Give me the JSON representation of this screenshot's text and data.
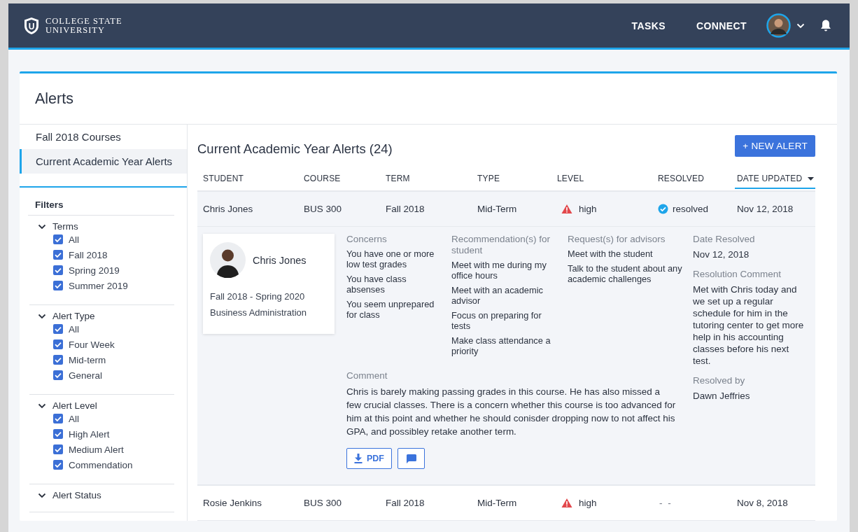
{
  "header": {
    "logo_letter": "U",
    "logo_line1": "COLLEGE STATE",
    "logo_line2": "UNIVERSITY",
    "nav": [
      "TASKS",
      "CONNECT"
    ]
  },
  "page_title": "Alerts",
  "sidebar": {
    "items": [
      {
        "label": "Fall 2018 Courses",
        "selected": false
      },
      {
        "label": "Current Academic Year Alerts",
        "selected": true
      }
    ],
    "filters_title": "Filters",
    "groups": [
      {
        "title": "Terms",
        "expanded": true,
        "items": [
          {
            "label": "All",
            "checked": true
          },
          {
            "label": "Fall 2018",
            "checked": true
          },
          {
            "label": "Spring 2019",
            "checked": true
          },
          {
            "label": "Summer 2019",
            "checked": true
          }
        ]
      },
      {
        "title": "Alert Type",
        "expanded": true,
        "items": [
          {
            "label": "All",
            "checked": true
          },
          {
            "label": "Four Week",
            "checked": true
          },
          {
            "label": "Mid-term",
            "checked": true
          },
          {
            "label": "General",
            "checked": true
          }
        ]
      },
      {
        "title": "Alert Level",
        "expanded": true,
        "items": [
          {
            "label": "All",
            "checked": true
          },
          {
            "label": "High Alert",
            "checked": true
          },
          {
            "label": "Medium Alert",
            "checked": true
          },
          {
            "label": "Commendation",
            "checked": true
          }
        ]
      },
      {
        "title": "Alert Status",
        "expanded": true
      }
    ]
  },
  "alerts": {
    "title": "Current Academic Year Alerts (24)",
    "new_button": "+ NEW ALERT",
    "columns": [
      {
        "label": "STUDENT",
        "sorted": false
      },
      {
        "label": "COURSE",
        "sorted": false
      },
      {
        "label": "TERM",
        "sorted": false
      },
      {
        "label": "TYPE",
        "sorted": false
      },
      {
        "label": "LEVEL",
        "sorted": false
      },
      {
        "label": "RESOLVED",
        "sorted": false
      },
      {
        "label": "DATE UPDATED",
        "sorted": true
      }
    ],
    "rows": [
      {
        "student": "Chris Jones",
        "course": "BUS 300",
        "term": "Fall 2018",
        "type": "Mid-Term",
        "alert_level": "high",
        "kind": "warning",
        "resolved": true,
        "resolved_text": "resolved",
        "date": "Nov 12, 2018",
        "expanded": true,
        "detail": {
          "student_name": "Chris Jones",
          "period": "Fall 2018 - Spring 2020",
          "program": "Business Administration",
          "sections": [
            {
              "title": "Concerns",
              "items": [
                "You have one or more low test grades",
                "You have class absenses",
                "You seem unprepared for class"
              ]
            },
            {
              "title": "Recommendation(s) for student",
              "items": [
                "Meet with me during my office hours",
                "Meet with an academic advisor",
                "Focus on preparing for tests",
                "Make class attendance a priority"
              ]
            },
            {
              "title": "Request(s) for advisors",
              "items": [
                "Meet with the student",
                "Talk to the student about any academic challenges"
              ]
            }
          ],
          "comment_title": "Comment",
          "comment": "Chris is barely making passing grades in this course. He has also missed a few crucial classes. There is a concern whether this course is too advanced for him at this point and whether he should conisder dropping now to not affect his GPA, and possibley retake another term.",
          "pdf_button": "PDF",
          "date_resolved_title": "Date Resolved",
          "date_resolved": "Nov 12, 2018",
          "resolution_title": "Resolution Comment",
          "resolution": "Met with Chris today and we set up a regular schedule for him in the tutoring center to get more help in his accounting classes before his next test.",
          "resolved_by_title": "Resolved by",
          "resolved_by": "Dawn Jeffries"
        }
      },
      {
        "student": "Rosie Jenkins",
        "course": "BUS 300",
        "term": "Fall 2018",
        "type": "Mid-Term",
        "alert_level": "high",
        "kind": "warning",
        "resolved": false,
        "resolved_text": "- -",
        "date": "Nov 8, 2018",
        "expanded": false
      }
    ]
  }
}
